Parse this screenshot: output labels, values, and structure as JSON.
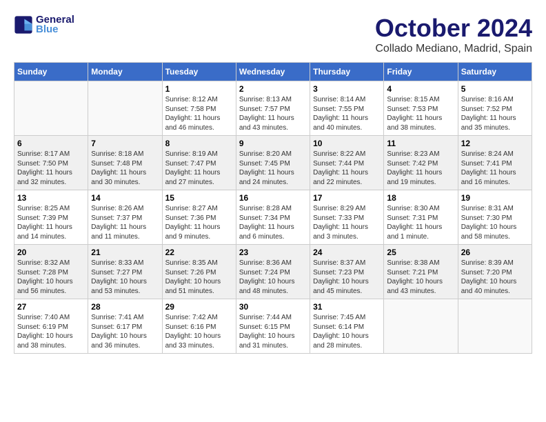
{
  "header": {
    "logo_line1": "General",
    "logo_line2": "Blue",
    "month_title": "October 2024",
    "subtitle": "Collado Mediano, Madrid, Spain"
  },
  "weekdays": [
    "Sunday",
    "Monday",
    "Tuesday",
    "Wednesday",
    "Thursday",
    "Friday",
    "Saturday"
  ],
  "weeks": [
    [
      {
        "day": "",
        "info": ""
      },
      {
        "day": "",
        "info": ""
      },
      {
        "day": "1",
        "info": "Sunrise: 8:12 AM\nSunset: 7:58 PM\nDaylight: 11 hours and 46 minutes."
      },
      {
        "day": "2",
        "info": "Sunrise: 8:13 AM\nSunset: 7:57 PM\nDaylight: 11 hours and 43 minutes."
      },
      {
        "day": "3",
        "info": "Sunrise: 8:14 AM\nSunset: 7:55 PM\nDaylight: 11 hours and 40 minutes."
      },
      {
        "day": "4",
        "info": "Sunrise: 8:15 AM\nSunset: 7:53 PM\nDaylight: 11 hours and 38 minutes."
      },
      {
        "day": "5",
        "info": "Sunrise: 8:16 AM\nSunset: 7:52 PM\nDaylight: 11 hours and 35 minutes."
      }
    ],
    [
      {
        "day": "6",
        "info": "Sunrise: 8:17 AM\nSunset: 7:50 PM\nDaylight: 11 hours and 32 minutes."
      },
      {
        "day": "7",
        "info": "Sunrise: 8:18 AM\nSunset: 7:48 PM\nDaylight: 11 hours and 30 minutes."
      },
      {
        "day": "8",
        "info": "Sunrise: 8:19 AM\nSunset: 7:47 PM\nDaylight: 11 hours and 27 minutes."
      },
      {
        "day": "9",
        "info": "Sunrise: 8:20 AM\nSunset: 7:45 PM\nDaylight: 11 hours and 24 minutes."
      },
      {
        "day": "10",
        "info": "Sunrise: 8:22 AM\nSunset: 7:44 PM\nDaylight: 11 hours and 22 minutes."
      },
      {
        "day": "11",
        "info": "Sunrise: 8:23 AM\nSunset: 7:42 PM\nDaylight: 11 hours and 19 minutes."
      },
      {
        "day": "12",
        "info": "Sunrise: 8:24 AM\nSunset: 7:41 PM\nDaylight: 11 hours and 16 minutes."
      }
    ],
    [
      {
        "day": "13",
        "info": "Sunrise: 8:25 AM\nSunset: 7:39 PM\nDaylight: 11 hours and 14 minutes."
      },
      {
        "day": "14",
        "info": "Sunrise: 8:26 AM\nSunset: 7:37 PM\nDaylight: 11 hours and 11 minutes."
      },
      {
        "day": "15",
        "info": "Sunrise: 8:27 AM\nSunset: 7:36 PM\nDaylight: 11 hours and 9 minutes."
      },
      {
        "day": "16",
        "info": "Sunrise: 8:28 AM\nSunset: 7:34 PM\nDaylight: 11 hours and 6 minutes."
      },
      {
        "day": "17",
        "info": "Sunrise: 8:29 AM\nSunset: 7:33 PM\nDaylight: 11 hours and 3 minutes."
      },
      {
        "day": "18",
        "info": "Sunrise: 8:30 AM\nSunset: 7:31 PM\nDaylight: 11 hours and 1 minute."
      },
      {
        "day": "19",
        "info": "Sunrise: 8:31 AM\nSunset: 7:30 PM\nDaylight: 10 hours and 58 minutes."
      }
    ],
    [
      {
        "day": "20",
        "info": "Sunrise: 8:32 AM\nSunset: 7:28 PM\nDaylight: 10 hours and 56 minutes."
      },
      {
        "day": "21",
        "info": "Sunrise: 8:33 AM\nSunset: 7:27 PM\nDaylight: 10 hours and 53 minutes."
      },
      {
        "day": "22",
        "info": "Sunrise: 8:35 AM\nSunset: 7:26 PM\nDaylight: 10 hours and 51 minutes."
      },
      {
        "day": "23",
        "info": "Sunrise: 8:36 AM\nSunset: 7:24 PM\nDaylight: 10 hours and 48 minutes."
      },
      {
        "day": "24",
        "info": "Sunrise: 8:37 AM\nSunset: 7:23 PM\nDaylight: 10 hours and 45 minutes."
      },
      {
        "day": "25",
        "info": "Sunrise: 8:38 AM\nSunset: 7:21 PM\nDaylight: 10 hours and 43 minutes."
      },
      {
        "day": "26",
        "info": "Sunrise: 8:39 AM\nSunset: 7:20 PM\nDaylight: 10 hours and 40 minutes."
      }
    ],
    [
      {
        "day": "27",
        "info": "Sunrise: 7:40 AM\nSunset: 6:19 PM\nDaylight: 10 hours and 38 minutes."
      },
      {
        "day": "28",
        "info": "Sunrise: 7:41 AM\nSunset: 6:17 PM\nDaylight: 10 hours and 36 minutes."
      },
      {
        "day": "29",
        "info": "Sunrise: 7:42 AM\nSunset: 6:16 PM\nDaylight: 10 hours and 33 minutes."
      },
      {
        "day": "30",
        "info": "Sunrise: 7:44 AM\nSunset: 6:15 PM\nDaylight: 10 hours and 31 minutes."
      },
      {
        "day": "31",
        "info": "Sunrise: 7:45 AM\nSunset: 6:14 PM\nDaylight: 10 hours and 28 minutes."
      },
      {
        "day": "",
        "info": ""
      },
      {
        "day": "",
        "info": ""
      }
    ]
  ]
}
